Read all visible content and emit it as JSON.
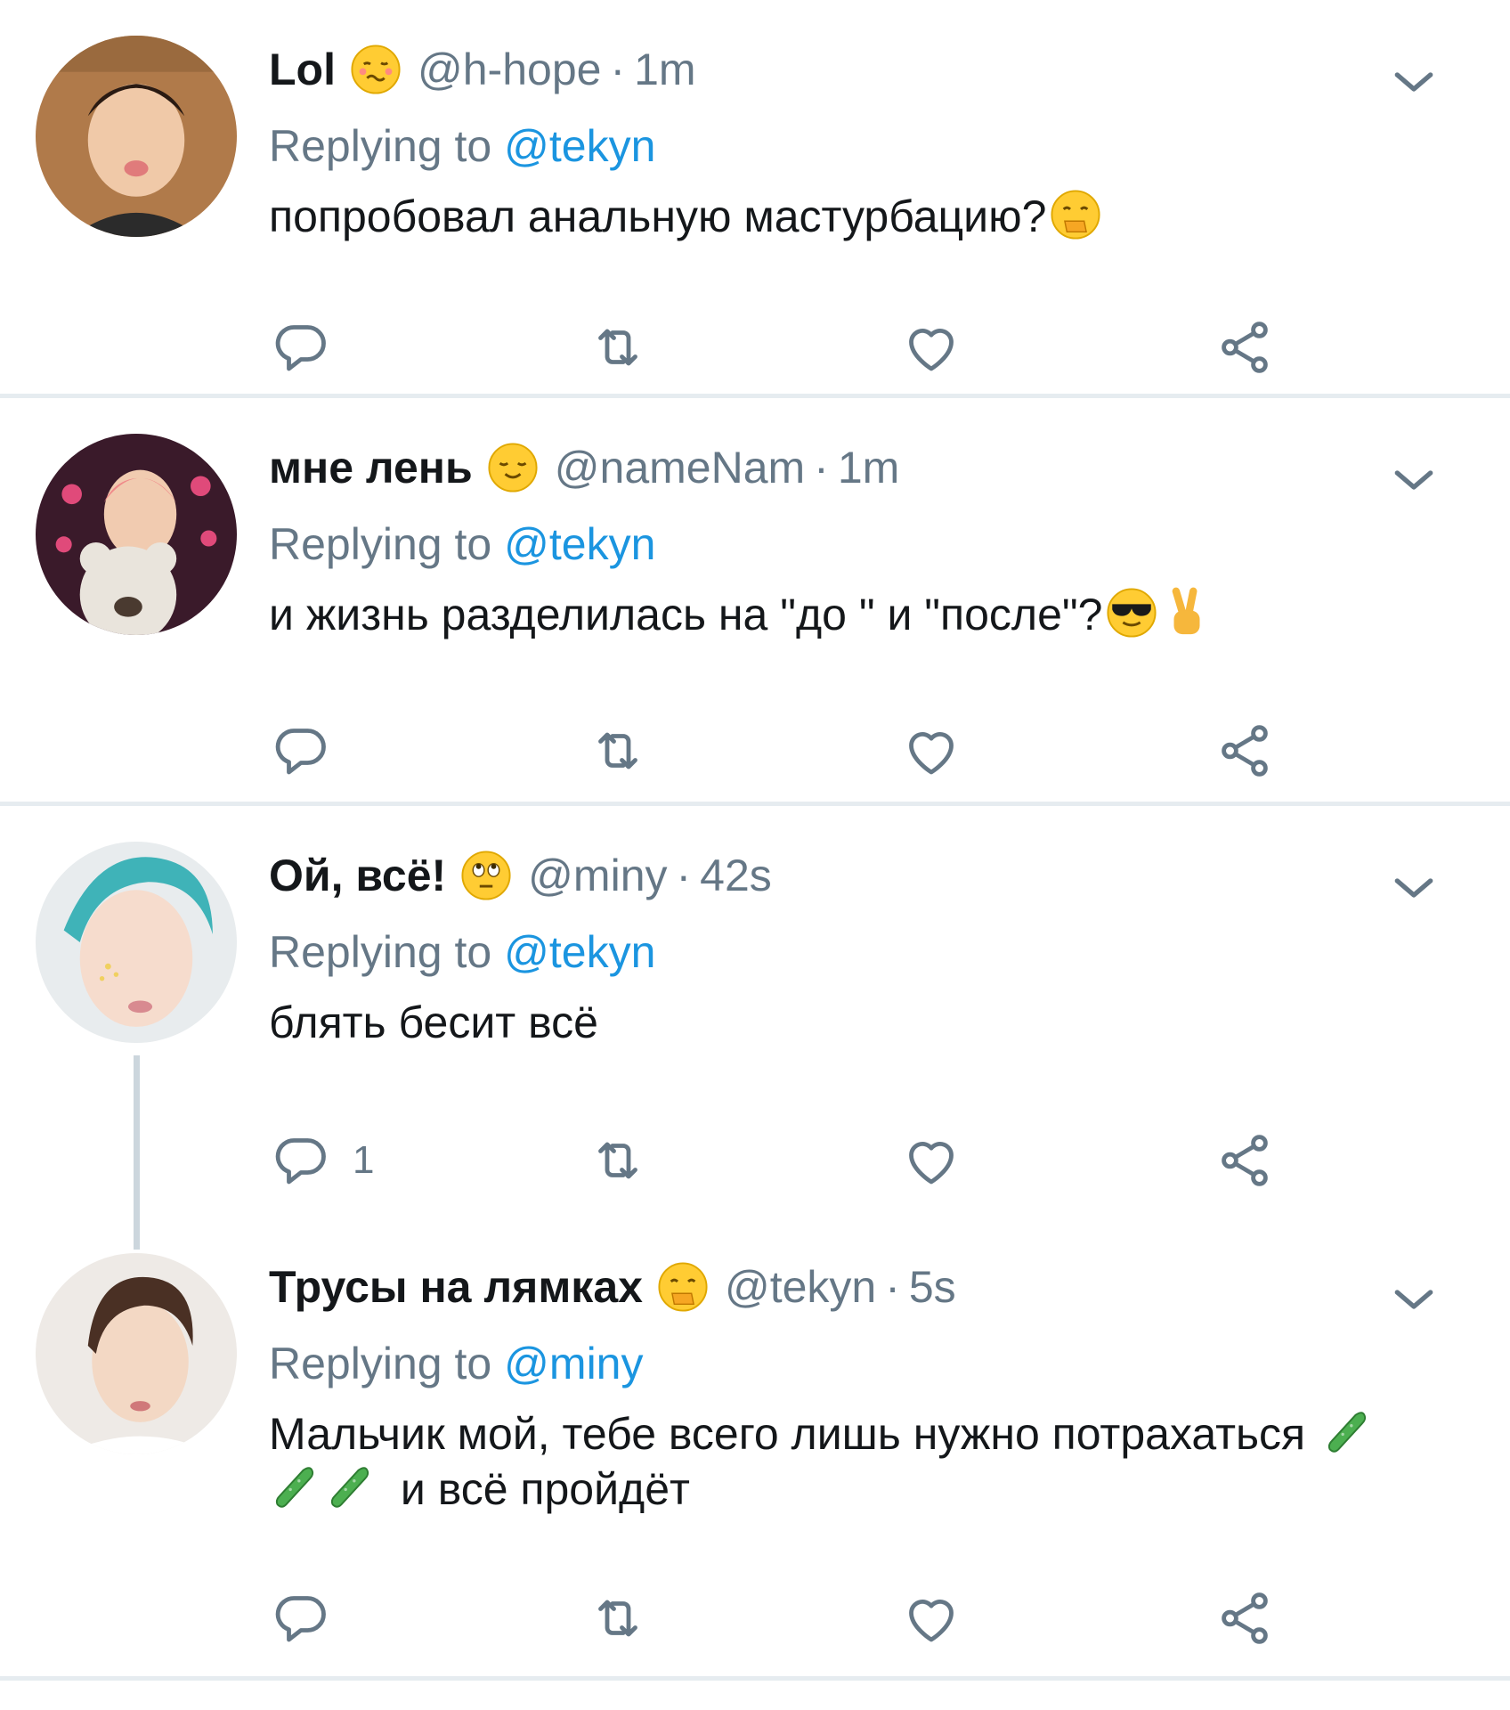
{
  "tweets": [
    {
      "display_name": "Lol",
      "name_emoji": "woozy-face-emoji",
      "handle": "@h-hope",
      "separator": "·",
      "time": "1m",
      "replying_label": "Replying to",
      "replying_to": "@tekyn",
      "text": "попробовал анальную мастурбацию?",
      "text_emojis": [
        "hand-over-mouth-emoji"
      ],
      "reply_count": ""
    },
    {
      "display_name": "мне лень",
      "name_emoji": "relieved-face-emoji",
      "handle": "@nameNam",
      "separator": "·",
      "time": "1m",
      "replying_label": "Replying to",
      "replying_to": "@tekyn",
      "text": "и жизнь разделилась на \"до \" и \"после\"?",
      "text_emojis": [
        "sunglasses-face-emoji",
        "victory-hand-emoji"
      ],
      "reply_count": ""
    },
    {
      "display_name": "Ой, всё!",
      "name_emoji": "rolling-eyes-emoji",
      "handle": "@miny",
      "separator": "·",
      "time": "42s",
      "replying_label": "Replying to",
      "replying_to": "@tekyn",
      "text": "блять бесит всё",
      "text_emojis": [],
      "reply_count": "1"
    },
    {
      "display_name": "Трусы на лямках",
      "name_emoji": "hand-over-mouth-emoji",
      "handle": "@tekyn",
      "separator": "·",
      "time": "5s",
      "replying_label": "Replying to",
      "replying_to": "@miny",
      "text_line1": "Мальчик мой, тебе всего лишь нужно потрахаться",
      "text_line2": "и всё пройдёт",
      "text_emojis": [
        "cucumber-emoji",
        "cucumber-emoji",
        "cucumber-emoji"
      ],
      "reply_count": ""
    }
  ],
  "icons": {
    "reply": "reply-icon",
    "retweet": "retweet-icon",
    "like": "heart-icon",
    "share": "share-icon",
    "menu": "chevron-down-icon"
  },
  "colors": {
    "link": "#1b95e0",
    "secondary_text": "#657786",
    "primary_text": "#14171a",
    "divider": "#e6ecf0",
    "icon": "#657786"
  }
}
